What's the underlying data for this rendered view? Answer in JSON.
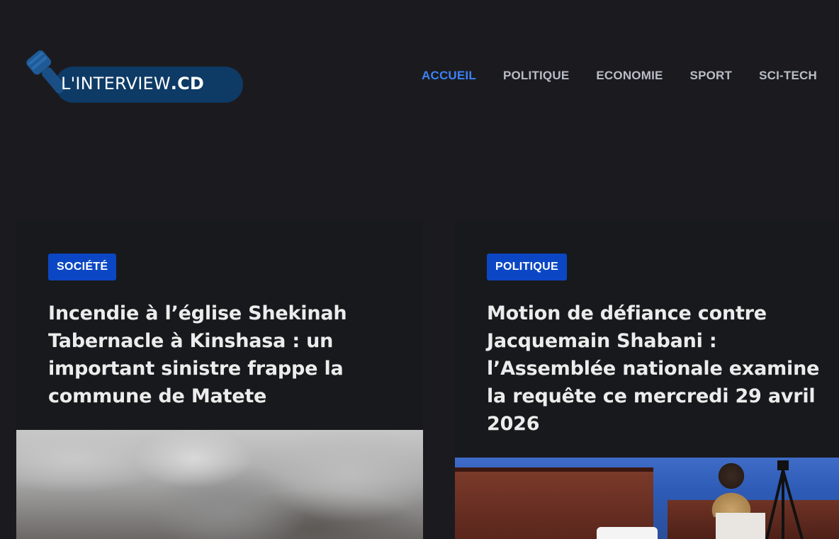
{
  "brand": {
    "logo_prefix": "L'INTERVIEW",
    "logo_suffix": ".CD",
    "logo_icon": "microphone-icon"
  },
  "nav": {
    "items": [
      {
        "label": "ACCUEIL",
        "active": true
      },
      {
        "label": "POLITIQUE",
        "active": false
      },
      {
        "label": "ECONOMIE",
        "active": false
      },
      {
        "label": "SPORT",
        "active": false
      },
      {
        "label": "SCI-TECH",
        "active": false
      }
    ]
  },
  "articles": [
    {
      "category": "SOCIÉTÉ",
      "title": "Incendie à l’église Shekinah Tabernacle à Kinshasa : un important sinistre frappe la commune de Matete",
      "image": "smoke-fire-photo"
    },
    {
      "category": "POLITIQUE",
      "title": "Motion de défiance contre Jacquemain Shabani : l’Assemblée nationale examine la requête ce mercredi 29 avril 2026",
      "image": "national-assembly-photo"
    }
  ],
  "colors": {
    "background": "#1b1b1f",
    "card": "#18191c",
    "accent": "#3b82f6",
    "badge": "#0b47c4",
    "logo_pill": "#0e3a66"
  }
}
